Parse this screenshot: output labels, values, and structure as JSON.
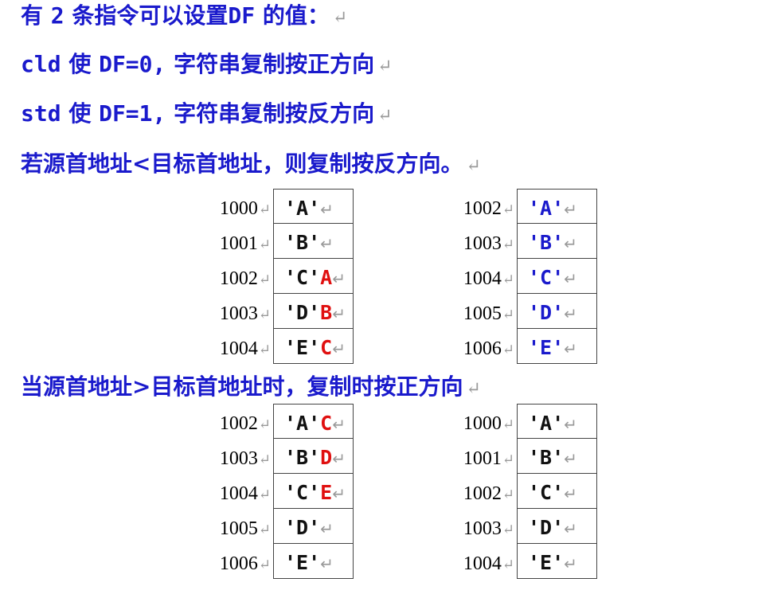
{
  "intro": {
    "text1": "有",
    "num": "2",
    "text2": "条指令可以设置",
    "df": "DF",
    "text3": "的值：",
    "mark": "↵"
  },
  "cld_line": {
    "cmd": "cld",
    "use": "使",
    "assign": "DF=0,",
    "rest": "字符串复制按正方向",
    "mark": "↵"
  },
  "std_line": {
    "cmd": "std",
    "use": "使",
    "assign": "DF=1,",
    "rest": "字符串复制按反方向",
    "mark": "↵"
  },
  "heading1": {
    "text": "若源首地址<目标首地址，则复制按反方向。",
    "mark": "↵"
  },
  "heading2": {
    "text": "当源首地址>目标首地址时，复制时按正方向",
    "mark": "↵"
  },
  "tables": {
    "t1": {
      "rows": [
        {
          "addr": "1000",
          "value": "'A'",
          "extra": "",
          "mark": "↵"
        },
        {
          "addr": "1001",
          "value": "'B'",
          "extra": "",
          "mark": "↵"
        },
        {
          "addr": "1002",
          "value": "'C'",
          "extra": "A",
          "mark": "↵"
        },
        {
          "addr": "1003",
          "value": "'D'",
          "extra": "B",
          "mark": "↵"
        },
        {
          "addr": "1004",
          "value": "'E'",
          "extra": "C",
          "mark": "↵"
        }
      ]
    },
    "t2": {
      "rows": [
        {
          "addr": "1002",
          "value": "'A'",
          "extra": "",
          "mark": "↵"
        },
        {
          "addr": "1003",
          "value": "'B'",
          "extra": "",
          "mark": "↵"
        },
        {
          "addr": "1004",
          "value": "'C'",
          "extra": "",
          "mark": "↵"
        },
        {
          "addr": "1005",
          "value": "'D'",
          "extra": "",
          "mark": "↵"
        },
        {
          "addr": "1006",
          "value": "'E'",
          "extra": "",
          "mark": "↵"
        }
      ]
    },
    "t3": {
      "rows": [
        {
          "addr": "1002",
          "value": "'A'",
          "extra": "C",
          "mark": "↵"
        },
        {
          "addr": "1003",
          "value": "'B'",
          "extra": "D",
          "mark": "↵"
        },
        {
          "addr": "1004",
          "value": "'C'",
          "extra": "E",
          "mark": "↵"
        },
        {
          "addr": "1005",
          "value": "'D'",
          "extra": "",
          "mark": "↵"
        },
        {
          "addr": "1006",
          "value": "'E'",
          "extra": "",
          "mark": "↵"
        }
      ]
    },
    "t4": {
      "rows": [
        {
          "addr": "1000",
          "value": "'A'",
          "extra": "",
          "mark": "↵"
        },
        {
          "addr": "1001",
          "value": "'B'",
          "extra": "",
          "mark": "↵"
        },
        {
          "addr": "1002",
          "value": "'C'",
          "extra": "",
          "mark": "↵"
        },
        {
          "addr": "1003",
          "value": "'D'",
          "extra": "",
          "mark": "↵"
        },
        {
          "addr": "1004",
          "value": "'E'",
          "extra": "",
          "mark": "↵"
        }
      ]
    }
  }
}
